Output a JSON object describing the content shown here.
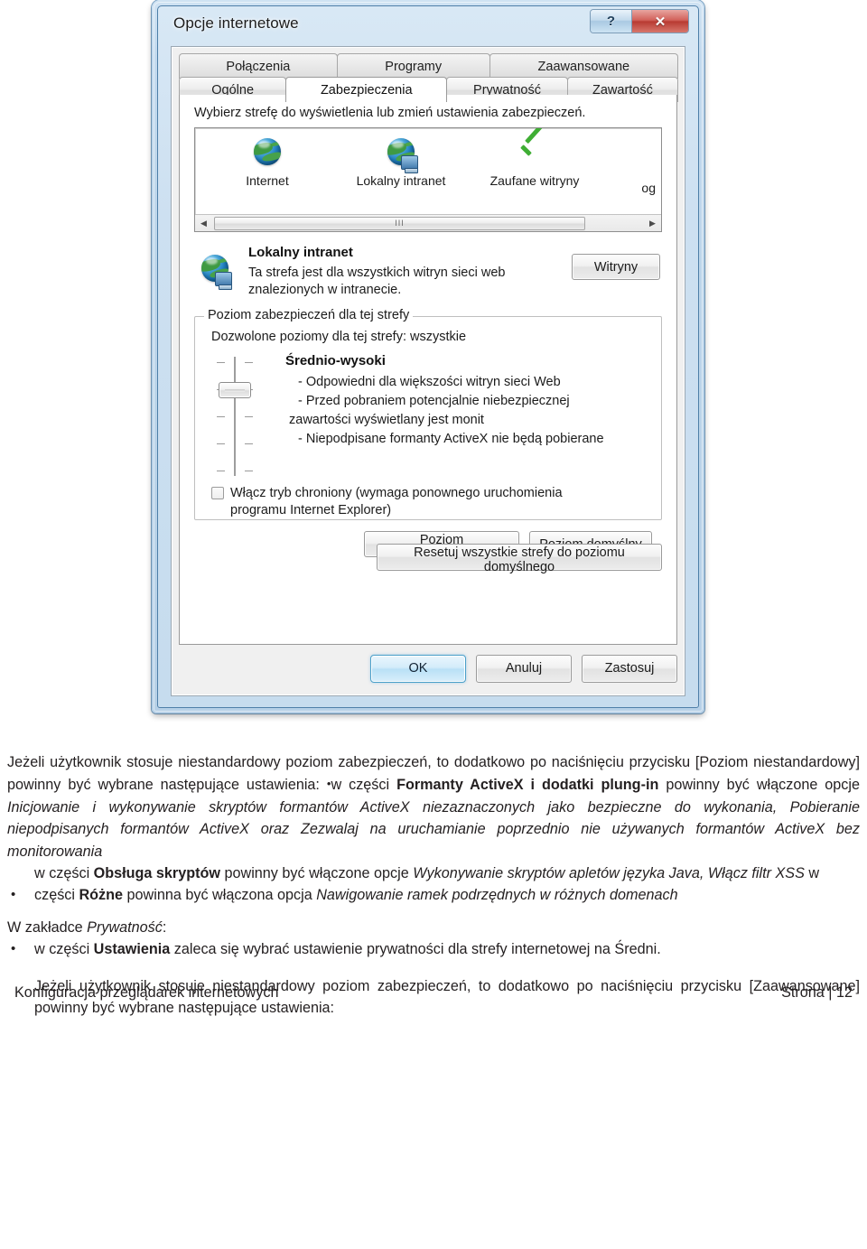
{
  "dialog": {
    "title": "Opcje internetowe",
    "caption_buttons": [
      {
        "name": "help",
        "glyph": "?"
      },
      {
        "name": "close",
        "glyph": "✕"
      }
    ],
    "tabs_top": [
      "Połączenia",
      "Programy",
      "Zaawansowane"
    ],
    "tabs_bottom": [
      "Ogólne",
      "Zabezpieczenia",
      "Prywatność",
      "Zawartość"
    ],
    "active_tab": "Zabezpieczenia",
    "hint": "Wybierz strefę do wyświetlenia lub zmień ustawienia zabezpieczeń.",
    "zones": [
      {
        "label": "Internet",
        "icon": "globe-icon"
      },
      {
        "label": "Lokalny intranet",
        "icon": "globe-computer-icon"
      },
      {
        "label": "Zaufane witryny",
        "icon": "green-check-icon"
      }
    ],
    "zone_clipped_text": "og",
    "scroll_thumb_glyph": "III",
    "selected_zone": {
      "title": "Lokalny intranet",
      "description": "Ta strefa jest dla wszystkich witryn sieci web znalezionych w intranecie.",
      "sites_button": "Witryny"
    },
    "level_group": {
      "title": "Poziom zabezpieczeń dla tej strefy",
      "allowed": "Dozwolone poziomy dla tej strefy: wszystkie",
      "level_name": "Średnio-wysoki",
      "level_lines": [
        "- Odpowiedni dla większości witryn sieci Web",
        "- Przed pobraniem potencjalnie niebezpiecznej",
        "zawartości wyświetlany jest monit",
        "- Niepodpisane formanty ActiveX nie będą pobierane"
      ],
      "protected_mode_label": "Włącz tryb chroniony (wymaga ponownego uruchomienia programu Internet Explorer)",
      "protected_mode_checked": false,
      "custom_level_button": "Poziom niestandardowy...",
      "default_level_button": "Poziom domyślny"
    },
    "reset_button": "Resetuj wszystkie strefy do poziomu domyślnego",
    "footer_buttons": {
      "ok": "OK",
      "cancel": "Anuluj",
      "apply": "Zastosuj"
    }
  },
  "document": {
    "p1": {
      "s1": "Jeżeli użytkownik stosuje niestandardowy poziom zabezpieczeń, to dodatkowo po naciśnięciu przycisku [Poziom niestandardowy] powinny być wybrane następujące ustawienia: ",
      "s2": "w części ",
      "s3": "Formanty ActiveX i dodatki plung-in",
      "s4": " powinny być włączone opcje ",
      "s5": "Inicjowanie i wykonywanie skryptów formantów ActiveX niezaznaczonych jako bezpieczne do wykonania, Pobieranie niepodpisanych formantów ActiveX oraz Zezwalaj na uruchamianie poprzednio nie używanych formantów ActiveX bez monitorowania"
    },
    "p2": {
      "s1": "w części ",
      "s2": "Obsługa skryptów",
      "s3": " powinny być włączone opcje ",
      "s4": "Wykonywanie skryptów apletów języka Java, Włącz filtr XSS",
      "s5": " w części ",
      "s6": "Różne",
      "s7": " powinna być włączona opcja ",
      "s8": "Nawigowanie ramek podrzędnych w różnych domenach"
    },
    "p3": {
      "s1": "W zakładce ",
      "s2": "Prywatność",
      "s3": ":"
    },
    "p4": {
      "s1": "w części ",
      "s2": "Ustawienia",
      "s3": " zaleca się wybrać ustawienie prywatności dla strefy internetowej na Średni."
    },
    "p5": {
      "s1": "Jeżeli użytkownik stosuje niestandardowy poziom zabezpieczeń, to dodatkowo po naciśnięciu przycisku [Zaawansowane] powinny być wybrane następujące ustawienia:"
    },
    "footer_left": "Konfiguracja przeglądarek internetowych",
    "footer_right": "Strona | 12"
  }
}
